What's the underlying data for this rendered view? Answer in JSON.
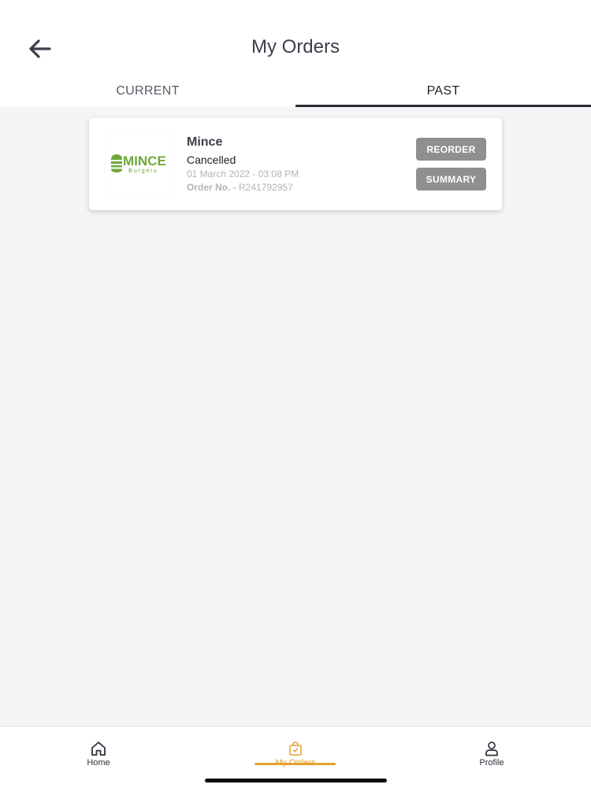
{
  "header": {
    "title": "My Orders"
  },
  "tabs": [
    {
      "label": "CURRENT",
      "active": false
    },
    {
      "label": "PAST",
      "active": true
    }
  ],
  "orders": [
    {
      "restaurant": "Mince",
      "logo_text_main": "MINCE",
      "logo_text_sub": "Burgers",
      "status": "Cancelled",
      "date": "01 March 2022 - 03:08 PM",
      "order_no_label": "Order No. -",
      "order_no": "R241792957",
      "reorder_label": "REORDER",
      "summary_label": "SUMMARY"
    }
  ],
  "bottom_nav": {
    "items": [
      {
        "label": "Home",
        "icon": "home-icon",
        "active": false
      },
      {
        "label": "My Orders",
        "icon": "shopping-bag-icon",
        "active": true
      },
      {
        "label": "Profile",
        "icon": "user-icon",
        "active": false
      }
    ]
  },
  "colors": {
    "accent": "#e4a232",
    "button_gray": "#8f8f92",
    "logo_green": "#6fa83a",
    "background": "#f5f4f7"
  }
}
